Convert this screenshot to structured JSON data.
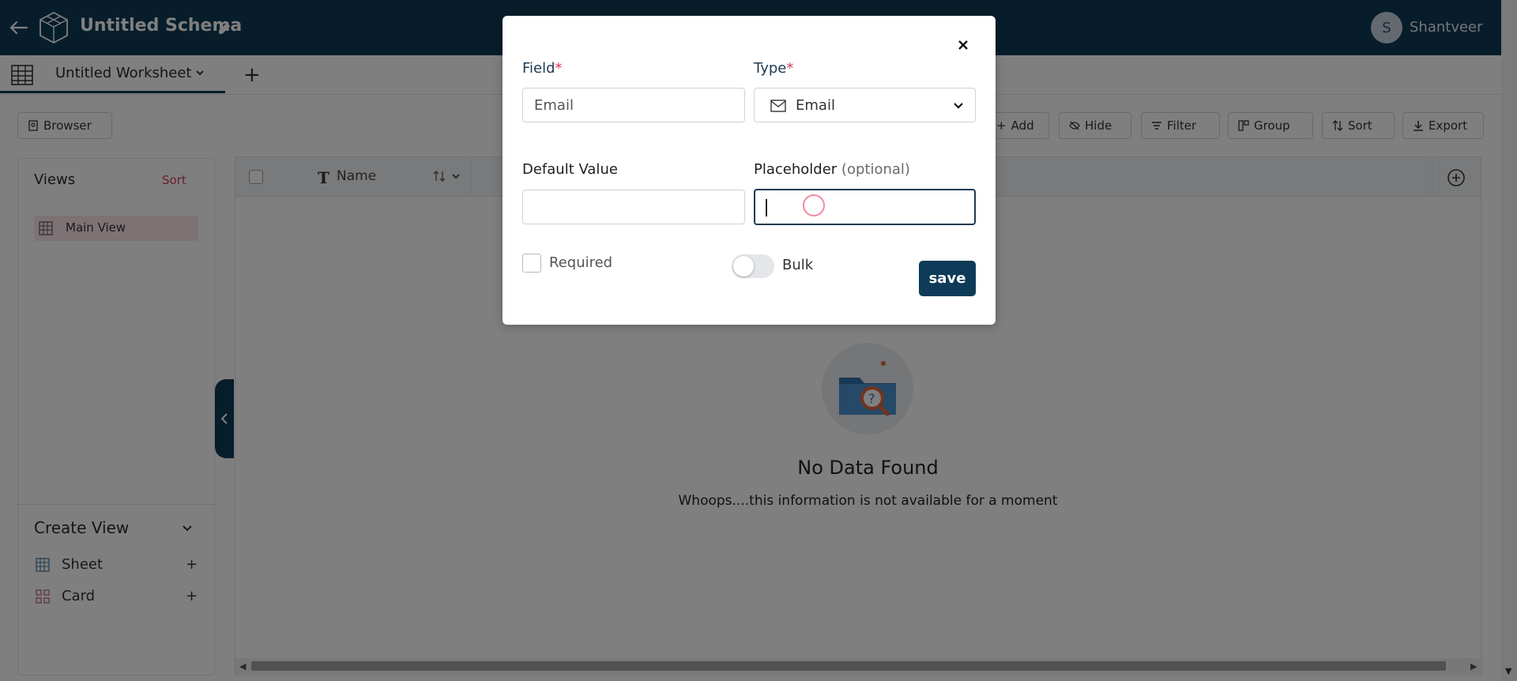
{
  "header": {
    "schema_title": "Untitled Schema",
    "user_initial": "S",
    "user_name": "Shantveer"
  },
  "tabs": {
    "worksheet_label": "Untitled Worksheet",
    "add_label": "+"
  },
  "toolbar": {
    "browser_label": "Browser",
    "add_label": "Add",
    "hide_label": "Hide",
    "filter_label": "Filter",
    "group_label": "Group",
    "sort_label": "Sort",
    "export_label": "Export"
  },
  "views": {
    "title": "Views",
    "sort_label": "Sort",
    "items": [
      {
        "label": "Main View"
      }
    ],
    "create_view_title": "Create View",
    "create_items": [
      {
        "label": "Sheet",
        "plus": "+"
      },
      {
        "label": "Card",
        "plus": "+"
      }
    ]
  },
  "table": {
    "columns": [
      {
        "label": "Name"
      }
    ]
  },
  "empty_state": {
    "title": "No Data Found",
    "subtitle": "Whoops....this information is not available for a moment"
  },
  "modal": {
    "field_label": "Field",
    "type_label": "Type",
    "required_star": "*",
    "field_value": "Email",
    "type_value": "Email",
    "default_value_label": "Default Value",
    "default_value": "",
    "placeholder_label": "Placeholder",
    "placeholder_optional": "(optional)",
    "placeholder_value": "",
    "required_label": "Required",
    "required_checked": false,
    "bulk_label": "Bulk",
    "bulk_on": false,
    "save_label": "save"
  },
  "colors": {
    "header_bg": "#0e3b57",
    "accent_pink": "#d33a5b",
    "selected_view_bg": "#fbe7eb",
    "overlay": "rgba(0,0,0,0.5)"
  }
}
